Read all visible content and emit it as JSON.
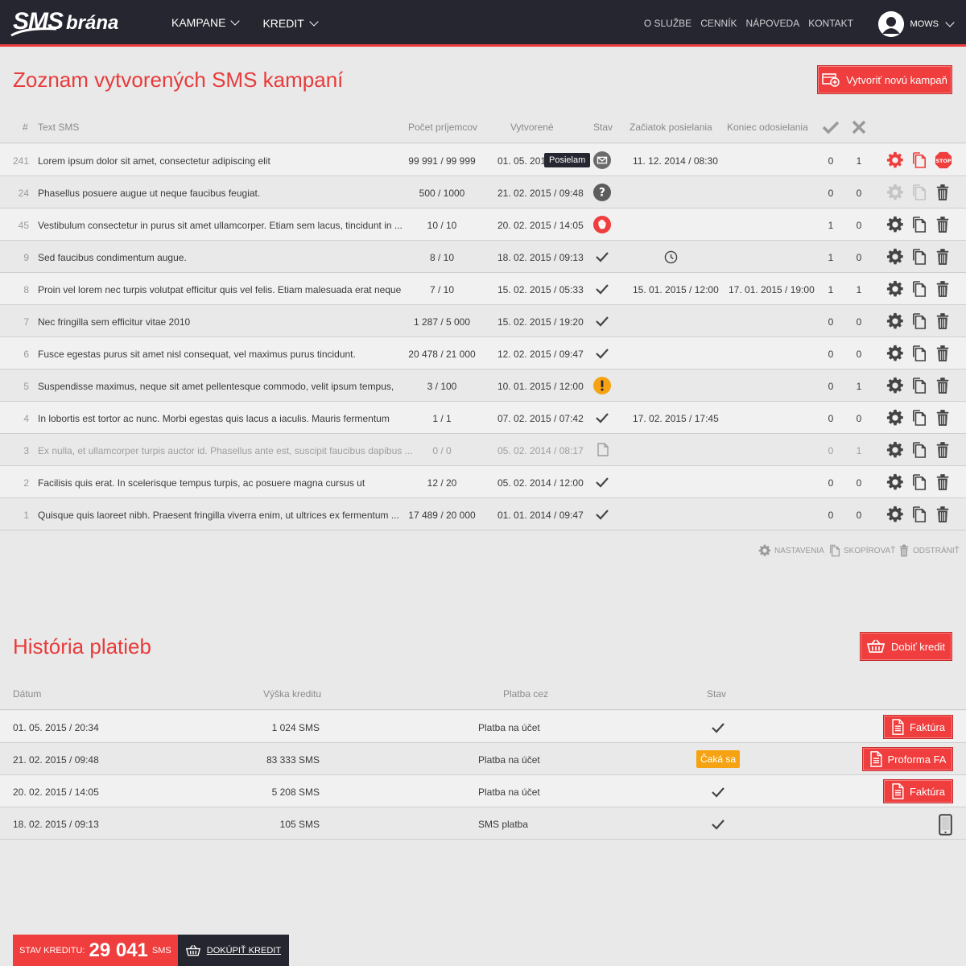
{
  "header": {
    "logo_sms": "SMS",
    "logo_brana": "brána",
    "nav": [
      {
        "label": "KAMPANE"
      },
      {
        "label": "KREDIT"
      }
    ],
    "links": [
      "O SLUŽBE",
      "CENNÍK",
      "NÁPOVEDA",
      "KONTAKT"
    ],
    "user_name": "MOWS"
  },
  "campaigns": {
    "title": "Zoznam vytvorených SMS kampaní",
    "new_button": "Vytvoriť novú kampaň",
    "columns": {
      "num": "#",
      "text": "Text SMS",
      "recipients": "Počet príjemcov",
      "created": "Vytvorené",
      "status": "Stav",
      "start": "Začiatok posielania",
      "end": "Koniec odosielania"
    },
    "tooltip": "Posielam",
    "rows": [
      {
        "id": "241",
        "text": "Lorem ipsum dolor sit amet, consectetur adipiscing elit",
        "recipients": "99 991 / 99 999",
        "created": "01. 05. 2015",
        "status": "sending",
        "start": "11. 12. 2014 / 08:30",
        "end": "",
        "ok": "0",
        "fail": "1"
      },
      {
        "id": "24",
        "text": "Phasellus posuere augue ut neque faucibus feugiat.",
        "recipients": "500 / 1000",
        "created": "21. 02. 2015 / 09:48",
        "status": "question",
        "start": "",
        "end": "",
        "ok": "0",
        "fail": "0"
      },
      {
        "id": "45",
        "text": "Vestibulum consectetur in purus sit amet ullamcorper. Etiam sem lacus, tincidunt in ...",
        "recipients": "10 / 10",
        "created": "20. 02. 2015 / 14:05",
        "status": "stopped",
        "start": "",
        "end": "",
        "ok": "1",
        "fail": "0"
      },
      {
        "id": "9",
        "text": "Sed faucibus condimentum augue.",
        "recipients": "8 / 10",
        "created": "18. 02. 2015 / 09:13",
        "status": "done",
        "start": "",
        "end": "",
        "ok": "1",
        "fail": "0"
      },
      {
        "id": "8",
        "text": "Proin vel lorem nec turpis volutpat efficitur quis vel felis. Etiam malesuada erat neque",
        "recipients": "7 / 10",
        "created": "15. 02. 2015 / 05:33",
        "status": "done",
        "start": "15. 01. 2015 / 12:00",
        "end": "17. 01. 2015 / 19:00",
        "ok": "1",
        "fail": "1"
      },
      {
        "id": "7",
        "text": "Nec fringilla sem efficitur vitae 2010",
        "recipients": "1 287 / 5 000",
        "created": "15. 02. 2015 / 19:20",
        "status": "done",
        "start": "",
        "end": "",
        "ok": "0",
        "fail": "0"
      },
      {
        "id": "6",
        "text": "Fusce egestas purus sit amet nisl consequat, vel maximus purus tincidunt.",
        "recipients": "20 478 / 21 000",
        "created": "12. 02. 2015 / 09:47",
        "status": "done",
        "start": "",
        "end": "",
        "ok": "0",
        "fail": "0"
      },
      {
        "id": "5",
        "text": "Suspendisse maximus, neque sit amet pellentesque commodo, velit ipsum tempus,",
        "recipients": "3 / 100",
        "created": "10. 01. 2015 / 12:00",
        "status": "warning",
        "start": "",
        "end": "",
        "ok": "0",
        "fail": "1"
      },
      {
        "id": "4",
        "text": "In lobortis est tortor ac nunc. Morbi egestas quis lacus a iaculis. Mauris fermentum",
        "recipients": "1 / 1",
        "created": "07. 02. 2015 / 07:42",
        "status": "done",
        "start": "17. 02. 2015 / 17:45",
        "end": "",
        "ok": "0",
        "fail": "0"
      },
      {
        "id": "3",
        "text": "Ex nulla, et ullamcorper turpis auctor id. Phasellus ante est, suscipit faucibus dapibus ...",
        "recipients": "0 / 0",
        "created": "05. 02. 2014 / 08:17",
        "status": "draft",
        "start": "",
        "end": "",
        "ok": "0",
        "fail": "1"
      },
      {
        "id": "2",
        "text": "Facilisis quis erat. In scelerisque tempus turpis, ac posuere magna cursus ut",
        "recipients": "12 / 20",
        "created": "05. 02. 2014 / 12:00",
        "status": "done",
        "start": "",
        "end": "",
        "ok": "0",
        "fail": "0"
      },
      {
        "id": "1",
        "text": "Quisque quis laoreet nibh. Praesent fringilla viverra enim, ut ultrices ex fermentum ...",
        "recipients": "17 489 / 20 000",
        "created": "01. 01. 2014 / 09:47",
        "status": "done",
        "start": "",
        "end": "",
        "ok": "0",
        "fail": "0"
      }
    ],
    "legend": {
      "settings": "NASTAVENIA",
      "copy": "SKOPÍROVAŤ",
      "delete": "ODSTRÁNIŤ"
    }
  },
  "payments": {
    "title": "História platieb",
    "topup_button": "Dobiť kredit",
    "columns": {
      "date": "Dátum",
      "amount": "Výška kreditu",
      "method": "Platba cez",
      "status": "Stav"
    },
    "rows": [
      {
        "date": "01. 05. 2015 / 20:34",
        "amount": "1 024 SMS",
        "method": "Platba na účet",
        "status": "done",
        "action": "Faktúra"
      },
      {
        "date": "21. 02. 2015 / 09:48",
        "amount": "83 333 SMS",
        "method": "Platba na účet",
        "status": "Čaká sa",
        "action": "Proforma FA"
      },
      {
        "date": "20. 02. 2015 / 14:05",
        "amount": "5 208 SMS",
        "method": "Platba na účet",
        "status": "done",
        "action": "Faktúra"
      },
      {
        "date": "18. 02. 2015 / 09:13",
        "amount": "105 SMS",
        "method": "SMS platba",
        "status": "done",
        "action": "phone"
      }
    ]
  },
  "credit": {
    "label": "STAV KREDITU:",
    "value": "29 041",
    "unit": "SMS",
    "buy_label": "DOKÚPIŤ KREDIT"
  },
  "colors": {
    "accent": "#f03d3d",
    "dark": "#25262f",
    "warning": "#f6a313"
  }
}
